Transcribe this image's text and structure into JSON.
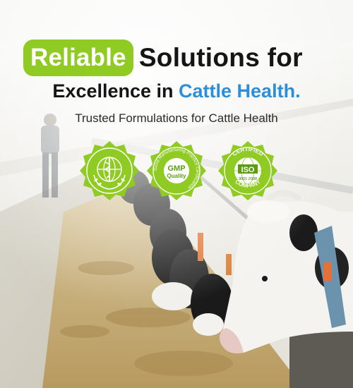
{
  "headline": {
    "highlight": "Reliable",
    "line1_rest": "Solutions for",
    "line2_plain": "Excellence in ",
    "line2_accent": "Cattle Health."
  },
  "subheadline": "Trusted Formulations for Cattle Health",
  "badges": [
    {
      "name": "WHO certification",
      "icon": "who-emblem-icon"
    },
    {
      "name": "GMP certification",
      "arc_text": "Good Manufacturing Practice Certification",
      "center_top": "GMP",
      "center_bottom": "Quality",
      "icon": "gmp-seal-icon"
    },
    {
      "name": "ISO certification",
      "top_text": "CERTIFIED",
      "bottom_text": "COMPANY",
      "center": "ISO",
      "standard": "9001:2008",
      "icon": "iso-seal-icon"
    }
  ],
  "colors": {
    "brand_green": "#8fcb22",
    "accent_blue": "#2b8fdc",
    "text_dark": "#151515"
  }
}
